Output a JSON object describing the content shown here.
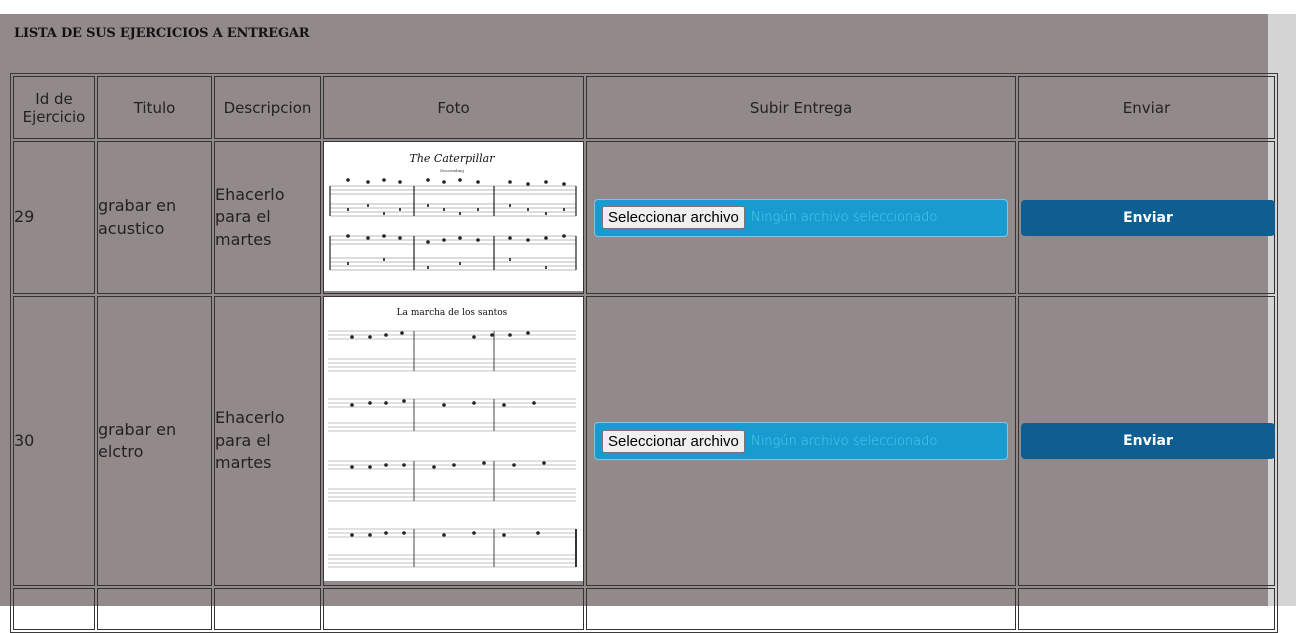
{
  "heading": "LISTA DE SUS EJERCICIOS A ENTREGAR",
  "columns": {
    "id": "Id de Ejercicio",
    "titulo": "Titulo",
    "descripcion": "Descripcion",
    "foto": "Foto",
    "subir": "Subir Entrega",
    "enviar": "Enviar"
  },
  "rows": [
    {
      "id": "29",
      "titulo": "grabar en acustico",
      "descripcion": "Ehacerlo para el martes",
      "foto_title": "The Caterpillar",
      "foto_subtitle": "Descending",
      "file_button": "Seleccionar archivo",
      "file_status": "Ningún archivo seleccionado",
      "send_label": "Enviar"
    },
    {
      "id": "30",
      "titulo": "grabar en elctro",
      "descripcion": "Ehacerlo para el martes",
      "foto_title": "La marcha de los santos",
      "file_button": "Seleccionar archivo",
      "file_status": "Ningún archivo seleccionado",
      "send_label": "Enviar"
    }
  ],
  "colors": {
    "panel_bg": "#928a8a",
    "upload_bg": "#1a9bd0",
    "send_bg": "#0e5e92"
  }
}
